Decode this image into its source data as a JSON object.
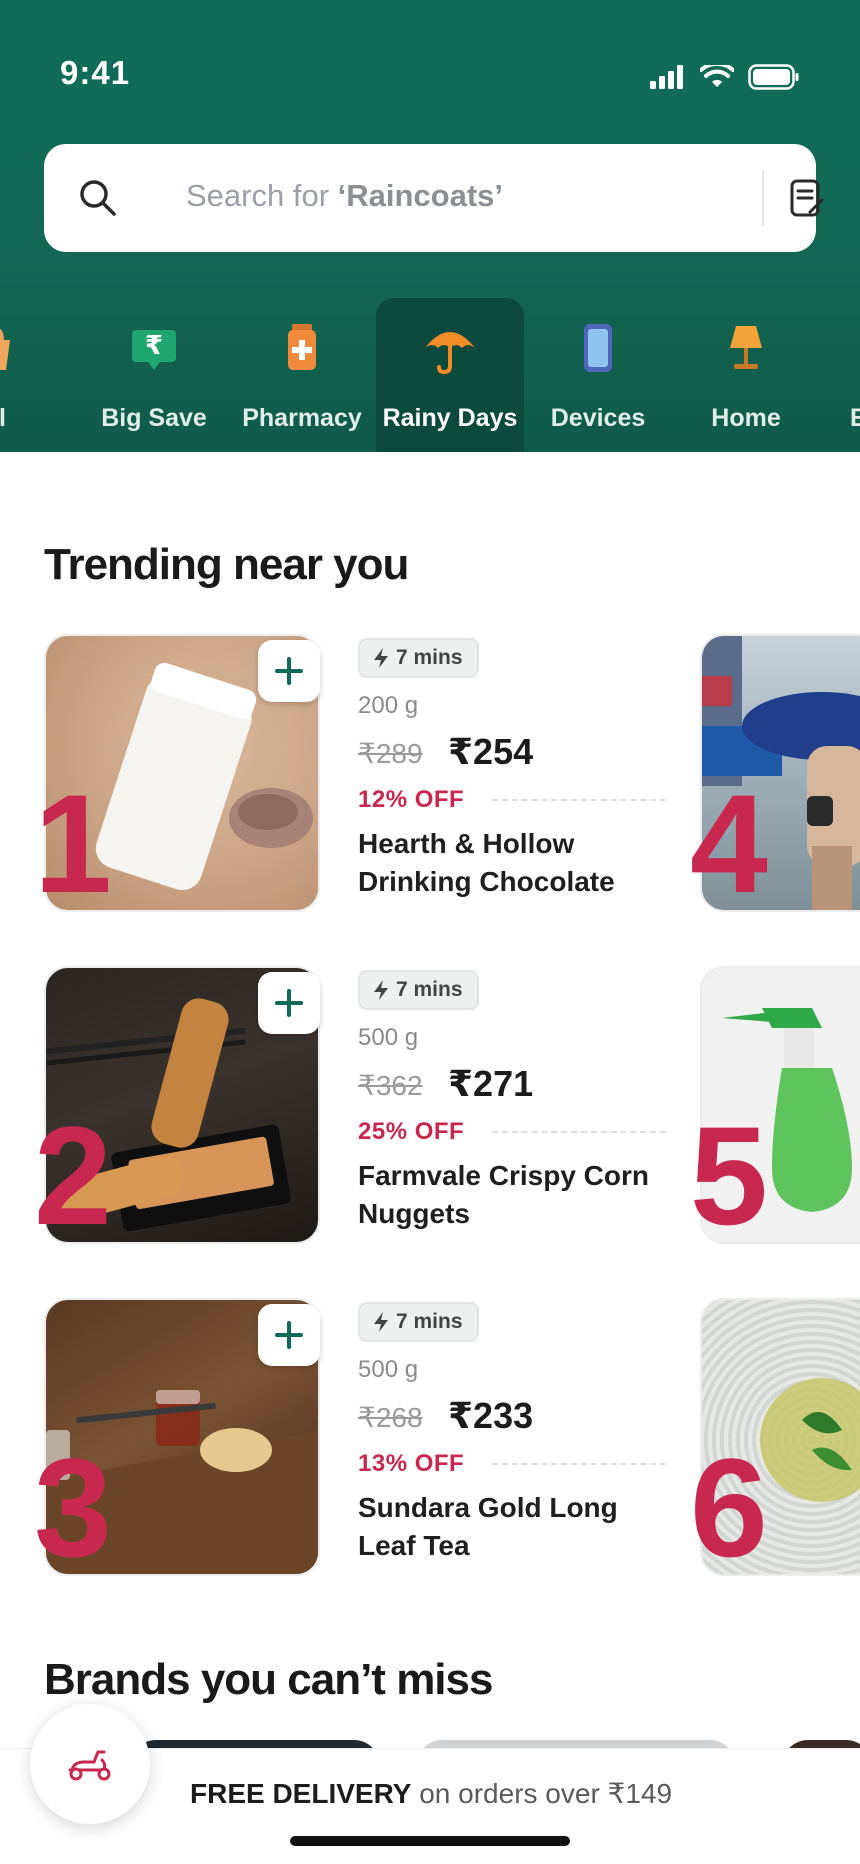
{
  "status": {
    "time": "9:41"
  },
  "search": {
    "prefix": "Search for ",
    "highlight": "‘Raincoats’"
  },
  "categories": [
    {
      "label": "All",
      "icon": "bag-icon"
    },
    {
      "label": "Big Save",
      "icon": "tag-icon"
    },
    {
      "label": "Pharmacy",
      "icon": "medicine-icon"
    },
    {
      "label": "Rainy Days",
      "icon": "umbrella-icon",
      "active": true
    },
    {
      "label": "Devices",
      "icon": "phone-icon"
    },
    {
      "label": "Home",
      "icon": "lamp-icon"
    },
    {
      "label": "E",
      "icon": ""
    }
  ],
  "trending": {
    "title": "Trending near you",
    "products": [
      {
        "rank": "1",
        "eta": "7 mins",
        "weight": "200 g",
        "mrp": "₹289",
        "price": "₹254",
        "discount": "12% OFF",
        "name": "Hearth & Hollow Drinking Chocolate"
      },
      {
        "rank": "2",
        "eta": "7 mins",
        "weight": "500 g",
        "mrp": "₹362",
        "price": "₹271",
        "discount": "25% OFF",
        "name": "Farmvale Crispy Corn Nuggets"
      },
      {
        "rank": "3",
        "eta": "7 mins",
        "weight": "500 g",
        "mrp": "₹268",
        "price": "₹233",
        "discount": "13% OFF",
        "name": "Sundara Gold Long Leaf Tea"
      }
    ],
    "side_ranks": [
      "4",
      "5",
      "6"
    ]
  },
  "brands": {
    "title": "Brands you can’t miss"
  },
  "delivery": {
    "bold": "FREE DELIVERY",
    "rest": " on orders over ₹149"
  },
  "colors": {
    "brand_green": "#0e6b5a",
    "accent_red": "#c8284e",
    "active_tab": "#0b4a3c"
  }
}
